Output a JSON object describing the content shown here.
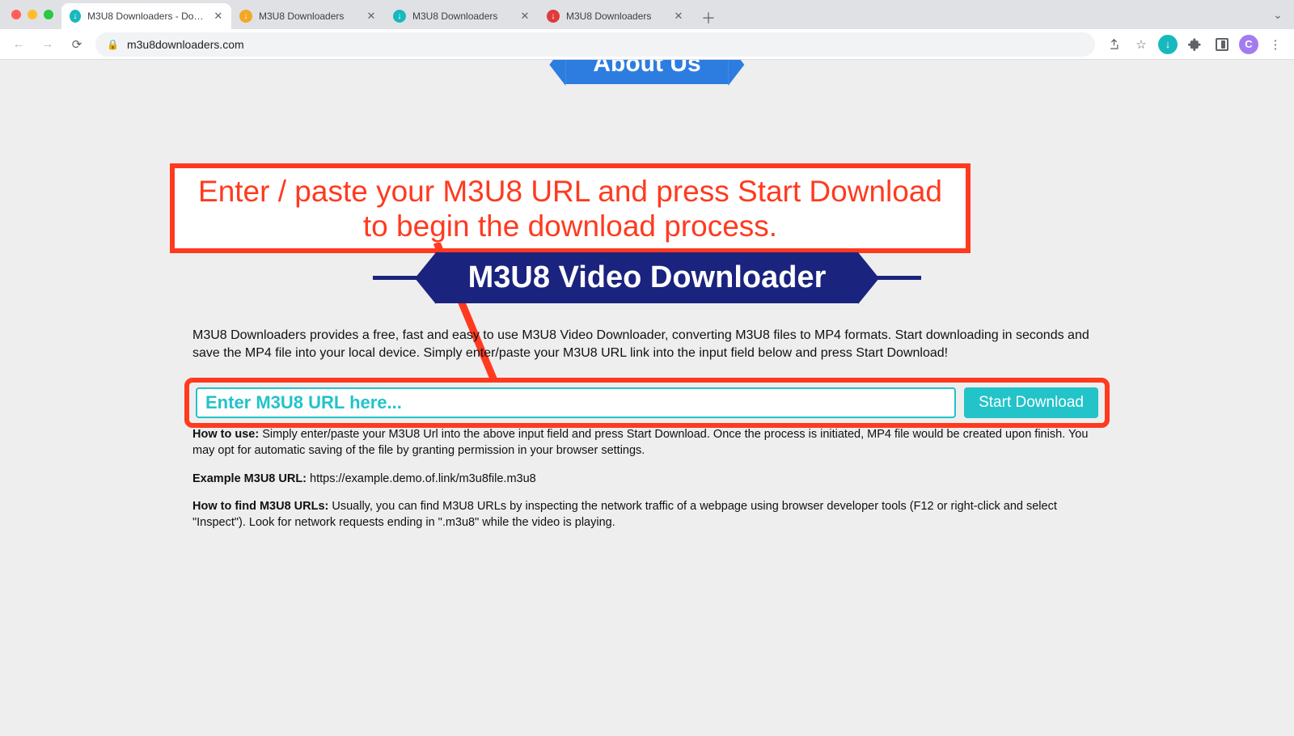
{
  "browser": {
    "tabs": [
      {
        "title": "M3U8 Downloaders - Downlo…",
        "favicon_color": "fav-teal"
      },
      {
        "title": "M3U8 Downloaders",
        "favicon_color": "fav-orange"
      },
      {
        "title": "M3U8 Downloaders",
        "favicon_color": "fav-teal"
      },
      {
        "title": "M3U8 Downloaders",
        "favicon_color": "fav-red"
      }
    ],
    "url": "m3u8downloaders.com",
    "profile_initial": "C"
  },
  "annotation": {
    "text": "Enter / paste your M3U8 URL and press Start Download to begin the download process."
  },
  "page": {
    "heading": "M3U8 Video Downloader",
    "intro": "M3U8 Downloaders provides a free, fast and easy to use M3U8 Video Downloader, converting M3U8 files to MP4 formats. Start downloading in seconds and save the MP4 file into your local device. Simply enter/paste your M3U8 URL link into the input field below and press Start Download!",
    "input_placeholder": "Enter M3U8 URL here...",
    "start_button": "Start Download",
    "how_to_use_label": "How to use:",
    "how_to_use_text": " Simply enter/paste your M3U8 Url into the above input field and press Start Download. Once the process is initiated, MP4 file would be created upon finish. You may opt for automatic saving of the file by granting permission in your browser settings.",
    "example_label": "Example M3U8 URL:",
    "example_text": " https://example.demo.of.link/m3u8file.m3u8",
    "find_label": "How to find M3U8 URLs:",
    "find_text": " Usually, you can find M3U8 URLs by inspecting the network traffic of a webpage using browser developer tools (F12 or right-click and select \"Inspect\"). Look for network requests ending in \".m3u8\" while the video is playing.",
    "about_heading": "About Us"
  }
}
